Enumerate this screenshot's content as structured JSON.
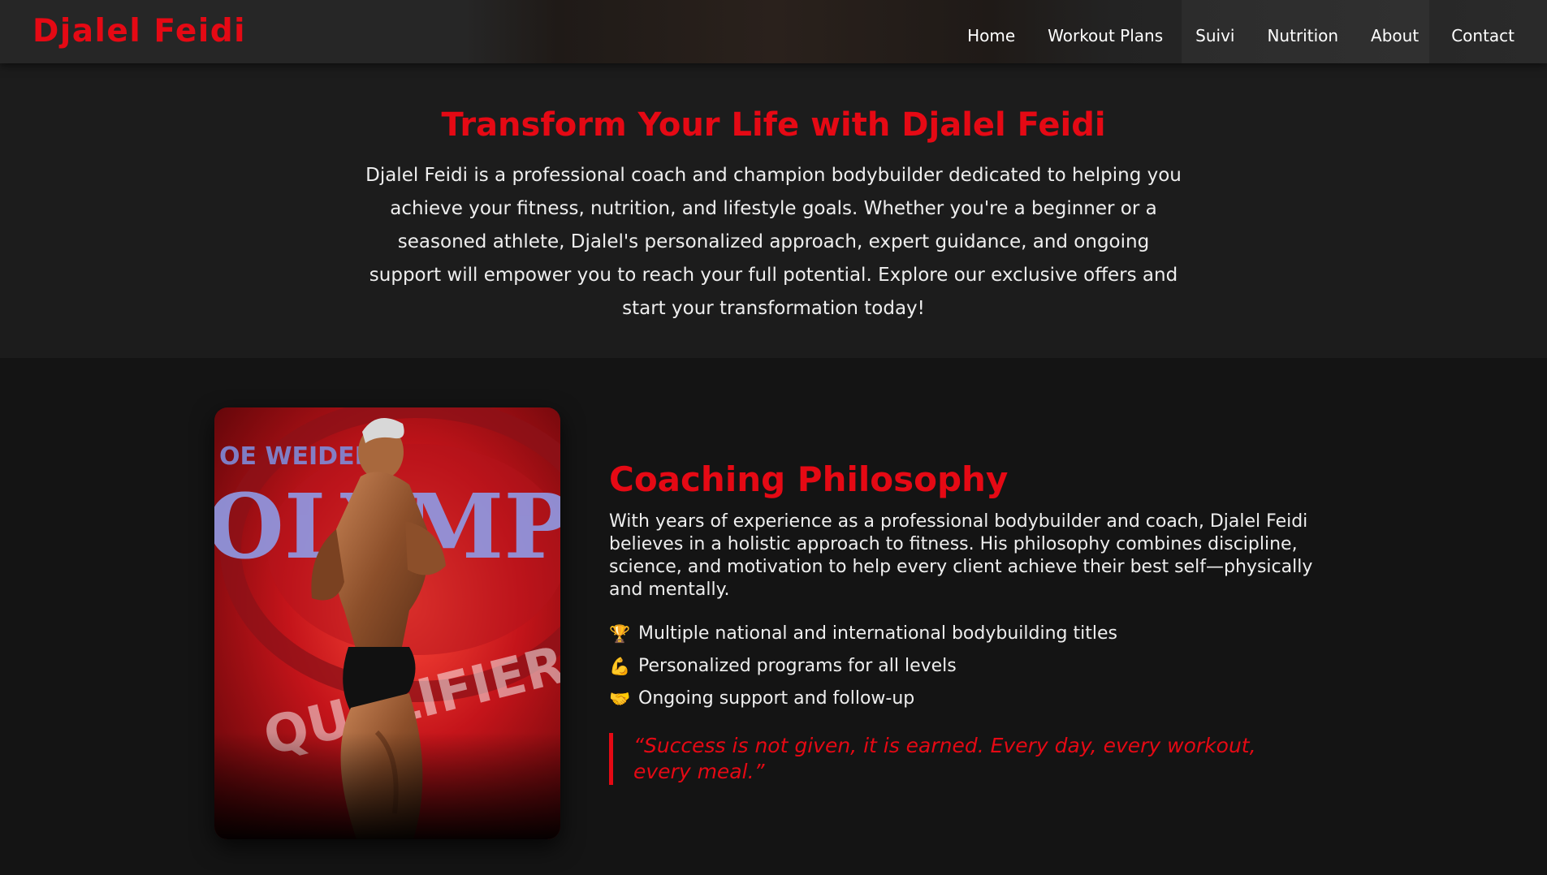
{
  "header": {
    "logo": "Djalel Feidi",
    "nav": [
      "Home",
      "Workout Plans",
      "Suivi",
      "Nutrition",
      "About",
      "Contact"
    ]
  },
  "hero": {
    "title": "Transform Your Life with Djalel Feidi",
    "text": "Djalel Feidi is a professional coach and champion bodybuilder dedicated to helping you achieve your fitness, nutrition, and lifestyle goals. Whether you're a beginner or a seasoned athlete, Djalel's personalized approach, expert guidance, and ongoing support will empower you to reach your full potential. Explore our exclusive offers and start your transformation today!"
  },
  "philosophy": {
    "image_text": {
      "banner": "OLYMPIA",
      "subtitle": "OE WEIDER'S",
      "bottom": "QUALIFIER"
    },
    "title": "Coaching Philosophy",
    "text": "With years of experience as a professional bodybuilder and coach, Djalel Feidi believes in a holistic approach to fitness. His philosophy combines discipline, science, and motivation to help every client achieve their best self—physically and mentally.",
    "features": [
      {
        "icon": "trophy-icon",
        "glyph": "🏆",
        "text": "Multiple national and international bodybuilding titles"
      },
      {
        "icon": "flexed-biceps-icon",
        "glyph": "💪",
        "text": "Personalized programs for all levels"
      },
      {
        "icon": "handshake-icon",
        "glyph": "🤝",
        "text": "Ongoing support and follow-up"
      }
    ],
    "quote": "“Success is not given, it is earned. Every day, every workout, every meal.”"
  },
  "colors": {
    "accent": "#e50914",
    "background": "#1a1a1a",
    "section_background": "#141414",
    "text": "#eeeeee"
  }
}
